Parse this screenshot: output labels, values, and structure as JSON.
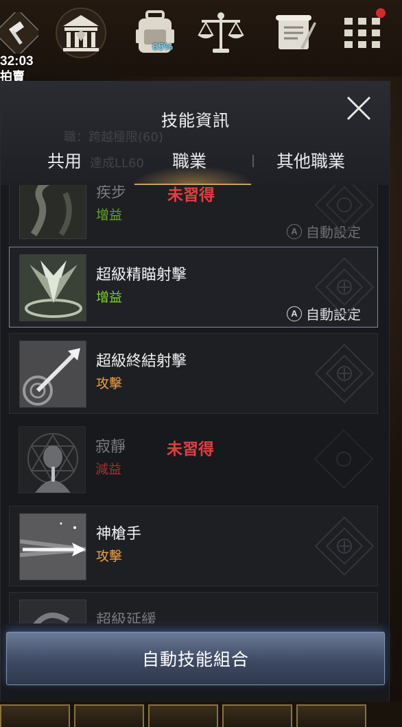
{
  "hud": {
    "timer": "32:03",
    "auction_label": "拍賣",
    "bag_percent": "65%",
    "icons": [
      "hammer-icon",
      "guild-hall-icon",
      "backpack-icon",
      "scales-icon",
      "scroll-icon",
      "menu-grid-icon"
    ],
    "notification_dot_color": "#d62a2a"
  },
  "panel": {
    "title": "技能資訊",
    "ghost_text_1": "職：跨越極限(60)",
    "ghost_text_2": "達成LL60",
    "tabs": [
      {
        "label": "共用",
        "active": false
      },
      {
        "label": "職業",
        "active": true
      },
      {
        "label": "其他職業",
        "active": false
      }
    ]
  },
  "skills": [
    {
      "name": "疾步",
      "type": "增益",
      "type_kind": "buff",
      "learned": false,
      "unlearned_label": "未習得",
      "auto_set": "自動設定",
      "auto_set_active": false,
      "selected": false
    },
    {
      "name": "超級精瞄射擊",
      "type": "增益",
      "type_kind": "buff",
      "learned": true,
      "auto_set": "自動設定",
      "auto_set_active": true,
      "selected": true
    },
    {
      "name": "超級終結射擊",
      "type": "攻擊",
      "type_kind": "attack",
      "learned": true,
      "selected": false
    },
    {
      "name": "寂靜",
      "type": "減益",
      "type_kind": "debuff",
      "learned": false,
      "unlearned_label": "未習得",
      "selected": false
    },
    {
      "name": "神槍手",
      "type": "攻擊",
      "type_kind": "attack",
      "learned": true,
      "selected": false
    },
    {
      "name": "超級延緩",
      "learned": true,
      "selected": false
    }
  ],
  "footer": {
    "auto_combo_label": "自動技能組合"
  },
  "colors": {
    "buff": "#7ed22f",
    "attack": "#f0a044",
    "debuff": "#a33030",
    "unlearned": "#e04040",
    "selected_border": "#7e8da6",
    "tab_underline": "#c9a264"
  }
}
